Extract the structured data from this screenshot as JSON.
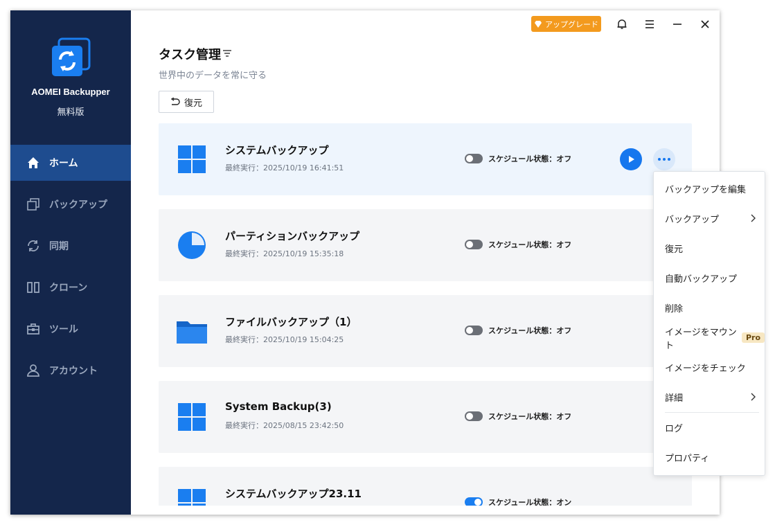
{
  "app": {
    "name": "AOMEI Backupper",
    "edition": "無料版"
  },
  "sidebar": {
    "items": [
      {
        "label": "ホーム",
        "icon": "home-icon",
        "active": true
      },
      {
        "label": "バックアップ",
        "icon": "copy-icon",
        "active": false
      },
      {
        "label": "同期",
        "icon": "sync-icon",
        "active": false
      },
      {
        "label": "クローン",
        "icon": "clone-icon",
        "active": false
      },
      {
        "label": "ツール",
        "icon": "toolbox-icon",
        "active": false
      },
      {
        "label": "アカウント",
        "icon": "user-icon",
        "active": false
      }
    ]
  },
  "topbar": {
    "upgrade_label": "アップグレード"
  },
  "main": {
    "title": "タスク管理",
    "subtitle": "世界中のデータを常に守る",
    "restore_label": "復元"
  },
  "tasks": [
    {
      "name": "システムバックアップ",
      "time": "最終実行：2025/10/19 16:41:51",
      "icon": "windows-icon",
      "schedule": "スケジュール状態：オフ",
      "on": false
    },
    {
      "name": "パーティションバックアップ",
      "time": "最終実行：2025/10/19 15:35:18",
      "icon": "partition-icon",
      "schedule": "スケジュール状態：オフ",
      "on": false
    },
    {
      "name": "ファイルバックアップ（1）",
      "time": "最終実行：2025/10/19 15:04:25",
      "icon": "folder-icon",
      "schedule": "スケジュール状態：オフ",
      "on": false
    },
    {
      "name": "System Backup(3)",
      "time": "最終実行：2025/08/15 23:42:50",
      "icon": "windows-icon",
      "schedule": "スケジュール状態：オフ",
      "on": false
    },
    {
      "name": "システムバックアップ23.11",
      "time": "",
      "icon": "windows-icon",
      "schedule": "スケジュール状態：オン",
      "on": true
    }
  ],
  "context_menu": {
    "items": [
      {
        "label": "バックアップを編集"
      },
      {
        "label": "バックアップ",
        "submenu": true
      },
      {
        "label": "復元"
      },
      {
        "label": "自動バックアップ"
      },
      {
        "label": "削除"
      },
      {
        "label": "イメージをマウント",
        "badge": "Pro"
      },
      {
        "label": "イメージをチェック"
      },
      {
        "label": "詳細",
        "submenu": true
      },
      {
        "label": "ログ"
      },
      {
        "label": "プロパティ"
      }
    ]
  },
  "colors": {
    "sidebar": "#14264b",
    "active": "#1e4c8f",
    "accent": "#1677ee",
    "upgrade": "#f39a1e"
  }
}
